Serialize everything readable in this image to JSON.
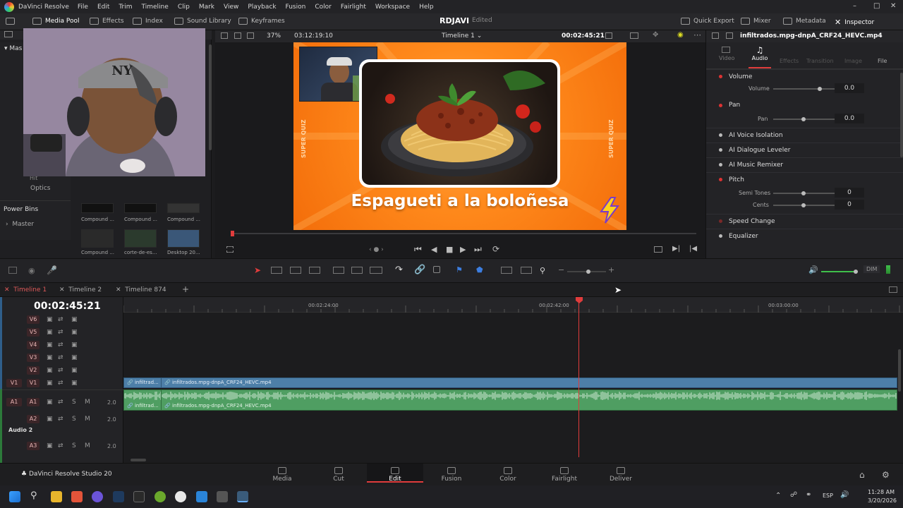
{
  "app": {
    "name": "DaVinci Resolve",
    "menus": [
      "File",
      "Edit",
      "Trim",
      "Timeline",
      "Clip",
      "Mark",
      "View",
      "Playback",
      "Fusion",
      "Color",
      "Fairlight",
      "Workspace",
      "Help"
    ],
    "project_name": "RDJAVI",
    "project_status": "Edited",
    "product": "DaVinci Resolve Studio 20"
  },
  "toolbar": {
    "media_pool": "Media Pool",
    "effects": "Effects",
    "index": "Index",
    "sound_library": "Sound Library",
    "keyframes": "Keyframes",
    "quick_export": "Quick Export",
    "mixer": "Mixer",
    "metadata": "Metadata",
    "inspector": "Inspector"
  },
  "media_pool": {
    "master_label": "Mas",
    "optics": "Optics",
    "hit": "Hit",
    "power_bins": "Power Bins",
    "master": "Master",
    "clips": [
      {
        "label": "Compound ...",
        "color": "#111"
      },
      {
        "label": "Compound ...",
        "color": "#111"
      },
      {
        "label": "Compound ...",
        "color": "#333"
      },
      {
        "label": "Compound ...",
        "color": "#2a2a2a"
      },
      {
        "label": "corte-de-es...",
        "color": "#2b3a2d"
      },
      {
        "label": "Desktop 20...",
        "color": "#3a5778"
      },
      {
        "label": "",
        "color": "#0c0c0c"
      },
      {
        "label": "",
        "color": "#2a0b10"
      },
      {
        "label": "",
        "color": "#b46ad0"
      }
    ]
  },
  "viewer": {
    "zoom": "37%",
    "source_timecode": "03:12:19:10",
    "timeline_name": "Timeline 1",
    "record_timecode": "00:02:45:21",
    "overlay_title": "Espagueti a la boloñesa",
    "side_text_left": "SUPER QUIZ",
    "side_text_right": "SUPER QUIZ"
  },
  "inspector": {
    "clip_name": "infiltrados.mpg-dnpA_CRF24_HEVC.mp4",
    "tabs": [
      "Video",
      "Audio",
      "Effects",
      "Transition",
      "Image",
      "File"
    ],
    "active_tab": "Audio",
    "volume_label": "Volume",
    "volume_param": "Volume",
    "volume_value": "0.0",
    "pan_label": "Pan",
    "pan_param": "Pan",
    "pan_value": "0.0",
    "ai_voice": "AI Voice Isolation",
    "ai_dialogue": "AI Dialogue Leveler",
    "ai_music": "AI Music Remixer",
    "pitch_label": "Pitch",
    "semi_tones_label": "Semi Tones",
    "semi_tones_value": "0",
    "cents_label": "Cents",
    "cents_value": "0",
    "speed_change": "Speed Change",
    "equalizer": "Equalizer"
  },
  "edit_tools": {
    "dim": "DIM"
  },
  "timeline_tabs": [
    "Timeline 1",
    "Timeline 2",
    "Timeline 874"
  ],
  "timeline": {
    "timecode": "00:02:45:21",
    "ruler_marks": [
      "00:02:24:00",
      "00:02:42:00",
      "00:03:00:00"
    ],
    "video_tracks": [
      "V6",
      "V5",
      "V4",
      "V3",
      "V2",
      "V1"
    ],
    "v1_source": "V1",
    "a1_source": "A1",
    "audio_tracks": [
      {
        "name": "A1",
        "level": "2.0"
      },
      {
        "name": "A2",
        "level": "2.0"
      },
      {
        "name": "A3",
        "level": "2.0"
      }
    ],
    "audio2_label": "Audio 2",
    "solo": "S",
    "mute": "M",
    "clip_short": "infiltrad...",
    "clip_full": "infiltrados.mpg-dnpA_CRF24_HEVC.mp4"
  },
  "pages": [
    "Media",
    "Cut",
    "Edit",
    "Fusion",
    "Color",
    "Fairlight",
    "Deliver"
  ],
  "active_page": "Edit",
  "taskbar": {
    "language": "ESP",
    "time": "11:28 AM",
    "date": "3/20/2026"
  },
  "colors": {
    "accent_red": "#e03c3c",
    "video_clip": "#4d7fa8",
    "audio_clip": "#4f9e62",
    "frame_orange": "#ff8a1c"
  }
}
